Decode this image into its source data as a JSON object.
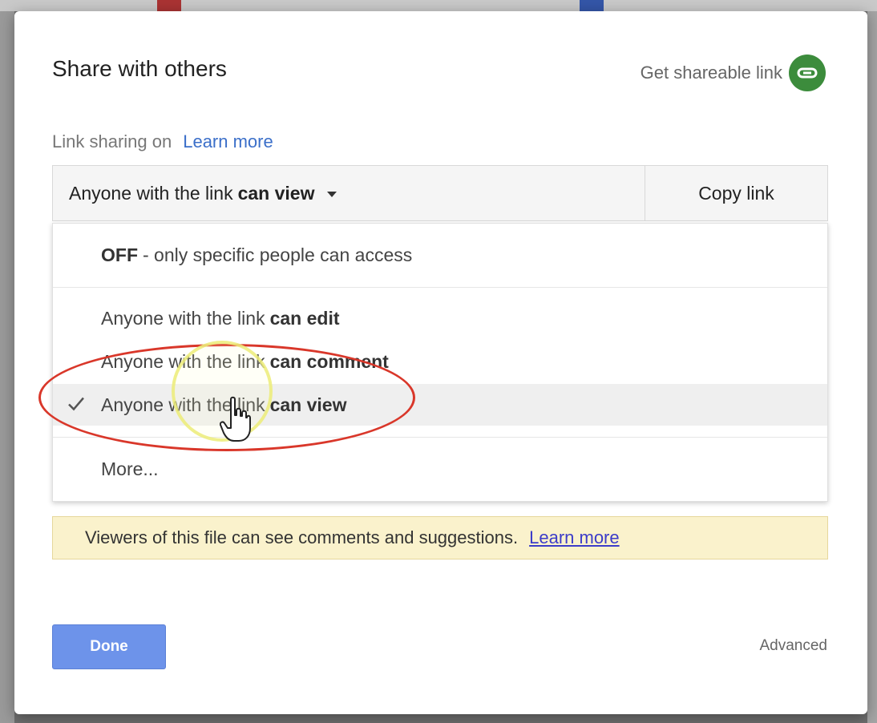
{
  "dialog": {
    "title": "Share with others",
    "shareable_link_label": "Get shareable link",
    "shareable_link_icon": "link-icon",
    "link_status": "Link sharing on",
    "learn_more_label": "Learn more",
    "access_level_prefix": "Anyone with the link",
    "access_level_value": "can view",
    "copy_link_label": "Copy link",
    "menu": {
      "off": {
        "bold": "OFF",
        "rest": "- only specific people can access"
      },
      "edit": {
        "prefix": "Anyone with the link",
        "bold": "can edit"
      },
      "comment": {
        "prefix": "Anyone with the link",
        "bold": "can comment"
      },
      "view": {
        "prefix": "Anyone with the link",
        "bold": "can view",
        "selected": true
      },
      "more": "More..."
    },
    "notice": {
      "text": "Viewers of this file can see comments and suggestions.",
      "link": "Learn more"
    },
    "done_label": "Done",
    "advanced_label": "Advanced"
  },
  "colors": {
    "accent_green": "#3c8c3c",
    "done_blue": "#6d93ea",
    "annotation_red": "#d9372a",
    "notice_bg": "#faf2cc"
  }
}
